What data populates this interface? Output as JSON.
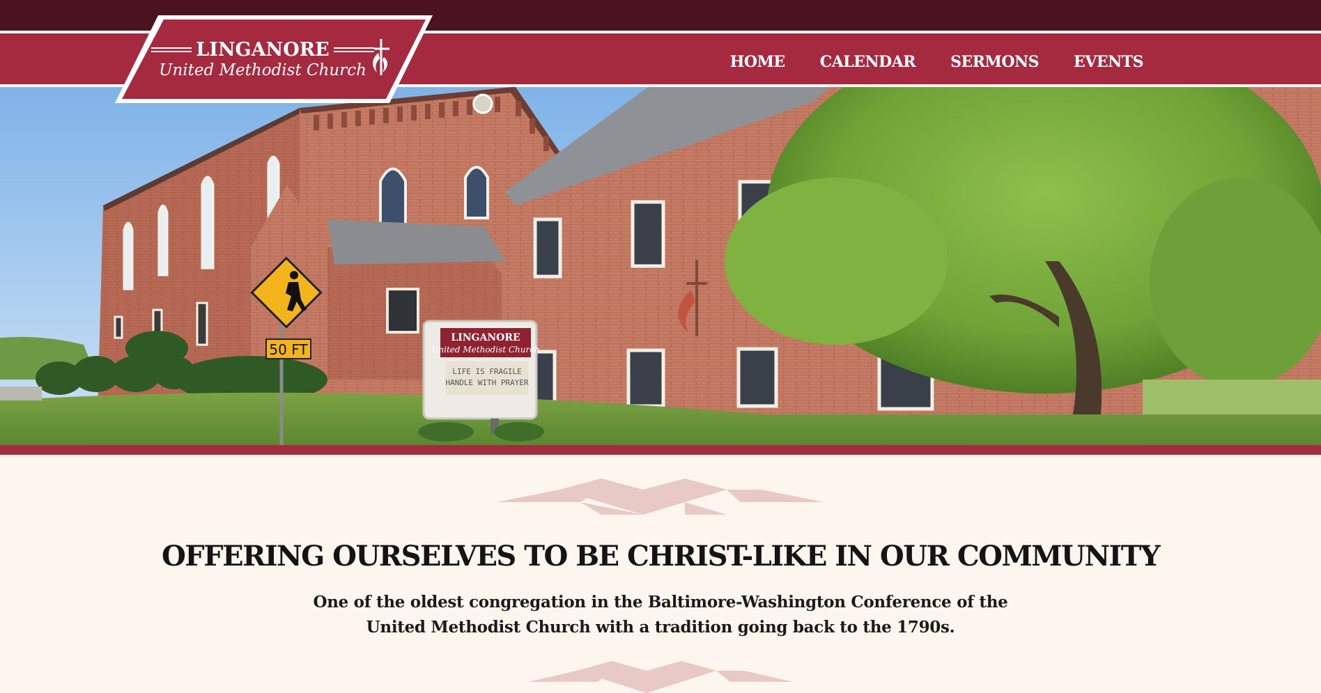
{
  "logo": {
    "line1": "LINGANORE",
    "line2": "United Methodist Church"
  },
  "nav": {
    "items": [
      {
        "label": "HOME"
      },
      {
        "label": "CALENDAR"
      },
      {
        "label": "SERMONS"
      },
      {
        "label": "EVENTS"
      }
    ]
  },
  "hero": {
    "sign_line1": "LINGANORE",
    "sign_line2": "United Methodist Church",
    "sign_msg1": "LIFE IS FRAGILE",
    "sign_msg2": "HANDLE WITH PRAYER",
    "road_sign": "50 FT"
  },
  "main": {
    "headline": "OFFERING OURSELVES TO BE CHRIST-LIKE IN OUR COMMUNITY",
    "subtext_line1": "One of the oldest congregation in the Baltimore-Washington Conference of the",
    "subtext_line2": "United Methodist Church with a tradition going back to the 1790s."
  },
  "colors": {
    "brand_red": "#a62a3f",
    "dark_maroon": "#4a131f",
    "cream": "#fdf6ee"
  }
}
